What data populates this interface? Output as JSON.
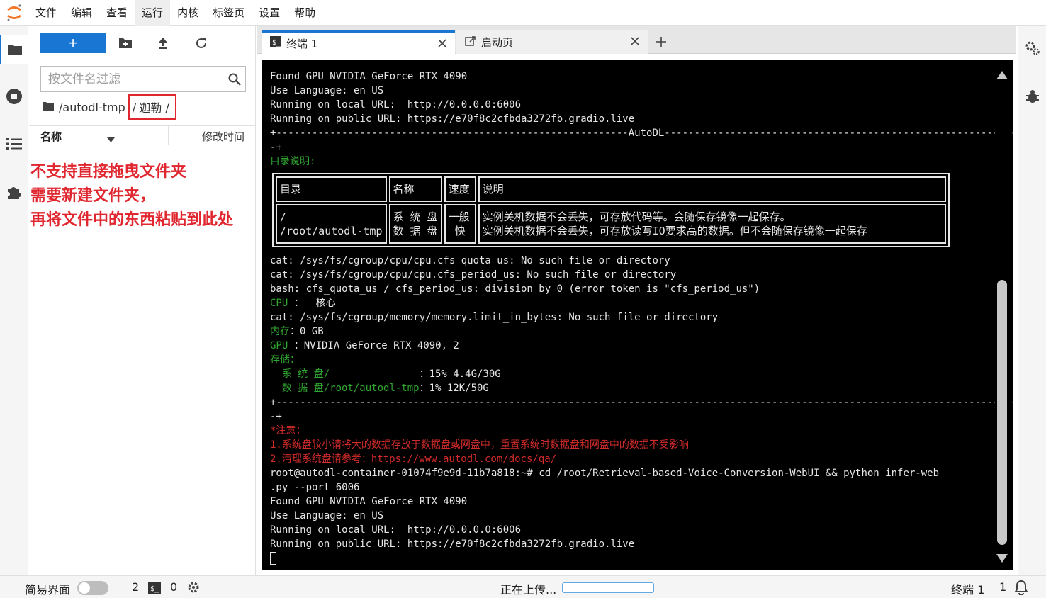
{
  "menu": [
    "文件",
    "编辑",
    "查看",
    "运行",
    "内核",
    "标签页",
    "设置",
    "帮助"
  ],
  "menu_active_index": 3,
  "filebrowser": {
    "new_label": "+",
    "filter_placeholder": "按文件名过滤",
    "breadcrumb_root": "/autodl-tmp",
    "breadcrumb_sep": "/",
    "breadcrumb_current": "迦勒 /",
    "col_name": "名称",
    "col_modified": "修改时间"
  },
  "annotation": [
    "不支持直接拖曳文件夹",
    "需要新建文件夹，",
    "再将文件中的东西粘贴到此处"
  ],
  "tabs": {
    "terminal_label": "终端 1",
    "launcher_label": "启动页",
    "add_label": "+"
  },
  "terminal": {
    "lines_top": [
      {
        "text": "Found GPU NVIDIA GeForce RTX 4090",
        "color": "default"
      },
      {
        "text": "Use Language: en_US",
        "color": "default"
      },
      {
        "text": "Running on local URL:  http://0.0.0.0:6006",
        "color": "default"
      },
      {
        "text": "Running on public URL: https://e70f8c2cfbda3272fb.gradio.live",
        "color": "default"
      },
      {
        "text": "+-----------------------------------------------------------AutoDL--------------------------------------------------------------",
        "color": "default"
      },
      {
        "text": "-+",
        "color": "default"
      },
      {
        "text": "目录说明:",
        "color": "green"
      }
    ],
    "table": {
      "headers": [
        "目录",
        "名称",
        "速度",
        "说明"
      ],
      "rows": [
        [
          "/\n/root/autodl-tmp",
          "系 统 盘\n数 据 盘",
          "一般\n 快 ",
          "实例关机数据不会丢失，可存放代码等。会随保存镜像一起保存。\n实例关机数据不会丢失，可存放读写IO要求高的数据。但不会随保存镜像一起保存"
        ]
      ]
    },
    "lines_bottom": [
      {
        "text": "cat: /sys/fs/cgroup/cpu/cpu.cfs_quota_us: No such file or directory",
        "color": "default"
      },
      {
        "text": "cat: /sys/fs/cgroup/cpu/cpu.cfs_period_us: No such file or directory",
        "color": "default"
      },
      {
        "text": "bash: cfs_quota_us / cfs_period_us: division by 0 (error token is \"cfs_period_us\")",
        "color": "default"
      },
      {
        "parts": [
          {
            "text": "CPU ",
            "color": "green"
          },
          {
            "text": "：  核心",
            "color": "default"
          }
        ]
      },
      {
        "text": "cat: /sys/fs/cgroup/memory/memory.limit_in_bytes: No such file or directory",
        "color": "default"
      },
      {
        "parts": [
          {
            "text": "内存",
            "color": "green"
          },
          {
            "text": "：0 GB",
            "color": "default"
          }
        ]
      },
      {
        "parts": [
          {
            "text": "GPU ",
            "color": "green"
          },
          {
            "text": "：NVIDIA GeForce RTX 4090, 2",
            "color": "default"
          }
        ]
      },
      {
        "text": "存储：",
        "color": "green"
      },
      {
        "parts": [
          {
            "text": "  系 统 盘/               ",
            "color": "green"
          },
          {
            "text": "：15% 4.4G/30G",
            "color": "default"
          }
        ]
      },
      {
        "parts": [
          {
            "text": "  数 据 盘/root/autodl-tmp",
            "color": "green"
          },
          {
            "text": "：1% 12K/50G",
            "color": "default"
          }
        ]
      },
      {
        "text": "+-------------------------------------------------------------------------------------------------------------------------------",
        "color": "default"
      },
      {
        "text": "-+",
        "color": "default"
      },
      {
        "text": "*注意：",
        "color": "red"
      },
      {
        "text": "1.系统盘较小请将大的数据存放于数据盘或网盘中，重置系统时数据盘和网盘中的数据不受影响",
        "color": "red"
      },
      {
        "text": "2.清理系统盘请参考：https://www.autodl.com/docs/qa/",
        "color": "red"
      },
      {
        "text": "root@autodl-container-01074f9e9d-11b7a818:~# cd /root/Retrieval-based-Voice-Conversion-WebUI && python infer-web",
        "color": "default"
      },
      {
        "text": ".py --port 6006",
        "color": "default"
      },
      {
        "text": "Found GPU NVIDIA GeForce RTX 4090",
        "color": "default"
      },
      {
        "text": "Use Language: en_US",
        "color": "default"
      },
      {
        "text": "Running on local URL:  http://0.0.0.0:6006",
        "color": "default"
      },
      {
        "text": "Running on public URL: https://e70f8c2cfbda3272fb.gradio.live",
        "color": "default"
      }
    ]
  },
  "colors": {
    "accent": "#1976d2",
    "annotation_red": "#e0262f",
    "terminal_green": "#31a831",
    "terminal_red": "#d12b2b"
  },
  "statusbar": {
    "simple_mode_label": "简易界面",
    "simple_mode_on": false,
    "terminal_count": "2",
    "kernel_count": "0",
    "upload_label": "正在上传...",
    "upload_progress": 0.0,
    "mode_label": "终端 1",
    "notification_count": "1"
  },
  "icons": [
    "jupyter-logo-icon",
    "folder-icon",
    "stop-circle-icon",
    "list-icon",
    "puzzle-icon",
    "new-folder-icon",
    "upload-icon",
    "refresh-icon",
    "search-icon",
    "terminal-icon",
    "launcher-icon",
    "close-icon",
    "plus-icon",
    "gears-icon",
    "debugger-icon",
    "bell-icon",
    "kernel-gear-icon"
  ]
}
